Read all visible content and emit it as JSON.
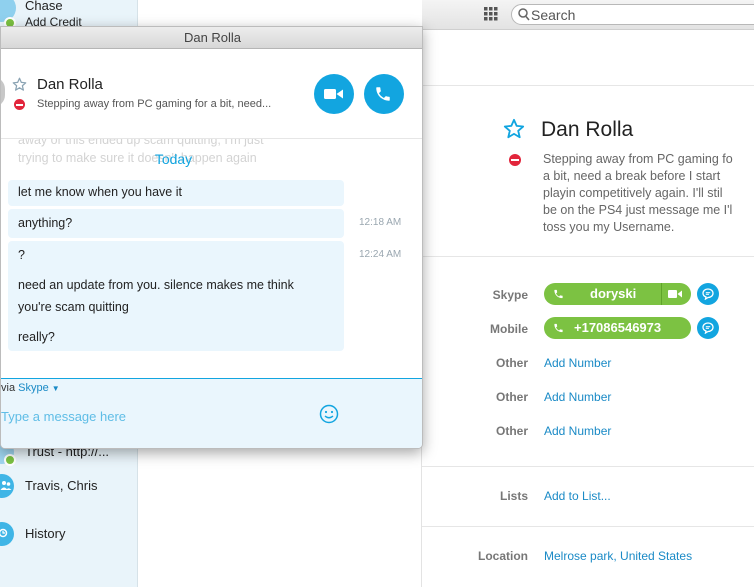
{
  "account": {
    "name": "Chase",
    "credit_link": "Add Credit"
  },
  "search": {
    "placeholder": "Search"
  },
  "sidebar": {
    "items": [
      {
        "label": "Trust - http://..."
      },
      {
        "label": "Travis, Chris"
      },
      {
        "label": "History"
      }
    ]
  },
  "chat_window": {
    "title": "Dan Rolla",
    "contact_name": "Dan Rolla",
    "mood": "Stepping away from PC gaming for a bit, need...",
    "faded_lines": [
      "away or this ended up scam quitting, I'm just",
      "trying to make sure it doesn't happen again"
    ],
    "day_label": "Today",
    "messages": [
      {
        "text": "let me know when you have it",
        "time": ""
      },
      {
        "text": "anything?",
        "time": "12:18 AM"
      },
      {
        "text": "?",
        "time": "12:24 AM"
      },
      {
        "text": "need an update from you. silence makes me think",
        "time": ""
      },
      {
        "text": "you're scam quitting",
        "time": ""
      },
      {
        "text": "really?",
        "time": ""
      }
    ],
    "via_prefix": "via",
    "via_service": "Skype",
    "input_placeholder": "Type a message here"
  },
  "profile": {
    "name": "Dan Rolla",
    "mood_lines": [
      "Stepping away from PC gaming fo",
      "a bit, need a break before I start",
      "playin competitively again. I'll stil",
      "be on the PS4 just message me I'l",
      "toss you my Username."
    ],
    "skype_label": "Skype",
    "skype_id": "doryski",
    "mobile_label": "Mobile",
    "mobile_number": "+17086546973",
    "other_rows": [
      {
        "label": "Other",
        "action": "Add Number"
      },
      {
        "label": "Other",
        "action": "Add Number"
      },
      {
        "label": "Other",
        "action": "Add Number"
      }
    ],
    "lists_label": "Lists",
    "lists_action": "Add to List...",
    "location_label": "Location",
    "location_value": "Melrose park, United States"
  },
  "colors": {
    "accent": "#12a5e0",
    "call_green": "#7cc242",
    "busy_red": "#e2253b",
    "sidebar_bg": "#e9f4fa"
  }
}
